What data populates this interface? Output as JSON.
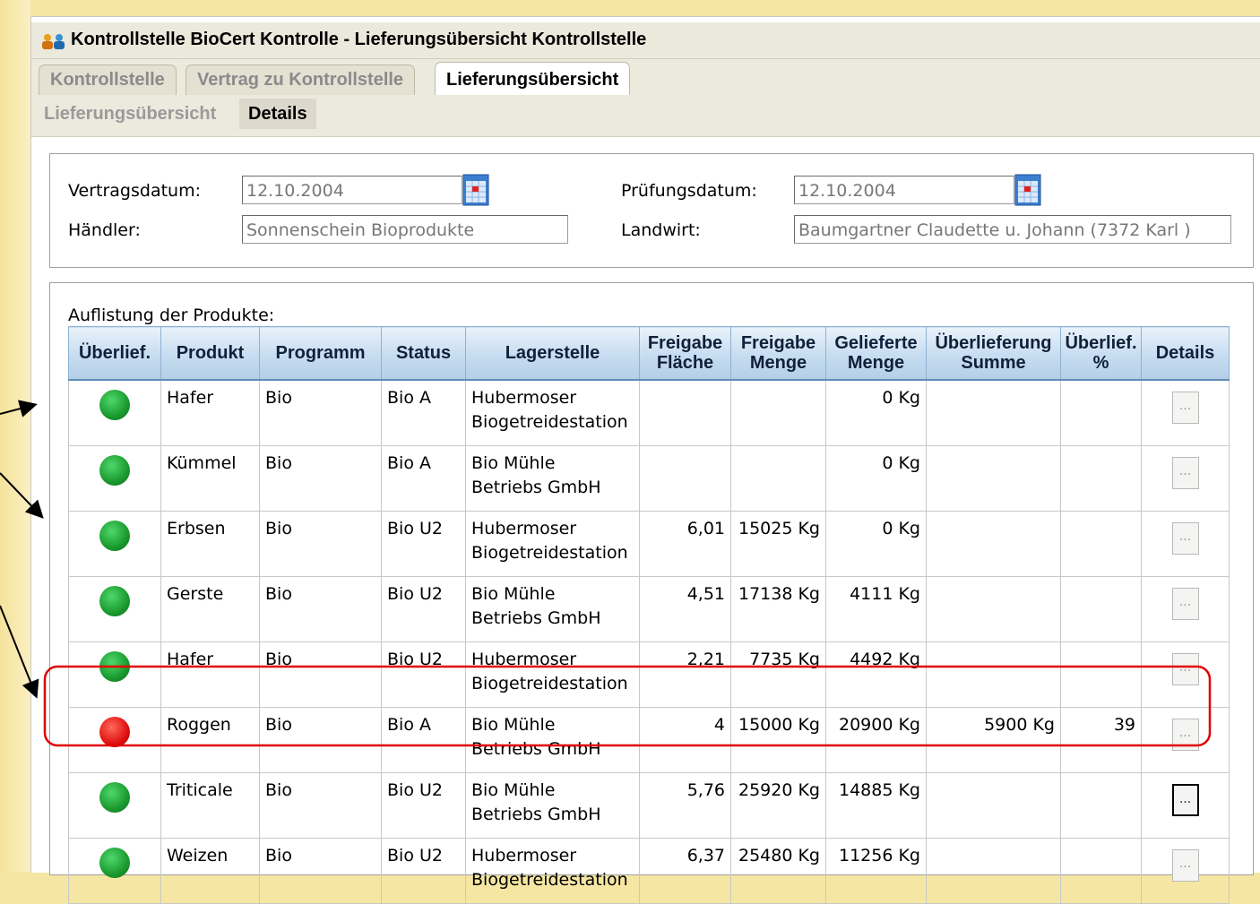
{
  "window": {
    "title": "Kontrollstelle BioCert Kontrolle - Lieferungsübersicht Kontrollstelle"
  },
  "tabs": [
    {
      "label": "Kontrollstelle",
      "active": false
    },
    {
      "label": "Vertrag zu Kontrollstelle",
      "active": false
    },
    {
      "label": "Lieferungsübersicht",
      "active": true
    }
  ],
  "subtabs": [
    {
      "label": "Lieferungsübersicht",
      "active": false
    },
    {
      "label": "Details",
      "active": true
    }
  ],
  "form": {
    "vertragsdatum_label": "Vertragsdatum:",
    "vertragsdatum_value": "12.10.2004",
    "haendler_label": "Händler:",
    "haendler_value": "Sonnenschein Bioprodukte",
    "pruefungsdatum_label": "Prüfungsdatum:",
    "pruefungsdatum_value": "12.10.2004",
    "landwirt_label": "Landwirt:",
    "landwirt_value": "Baumgartner Claudette u. Johann (7372 Karl )"
  },
  "products": {
    "title": "Auflistung der Produkte:",
    "columns": [
      "Überlief.",
      "Produkt",
      "Programm",
      "Status",
      "Lagerstelle",
      "Freigabe Fläche",
      "Freigabe Menge",
      "Gelieferte Menge",
      "Überlieferung Summe",
      "Überlief. %",
      "Details"
    ],
    "details_button_label": "...",
    "rows": [
      {
        "status_color": "green",
        "produkt": "Hafer",
        "programm": "Bio",
        "status": "Bio A",
        "lager1": "Hubermoser",
        "lager2": "Biogetreidestation",
        "flaeche": "",
        "menge": "",
        "geliefert": "0 Kg",
        "summe": "",
        "prozent": ""
      },
      {
        "status_color": "green",
        "produkt": "Kümmel",
        "programm": "Bio",
        "status": "Bio A",
        "lager1": "Bio Mühle",
        "lager2": "Betriebs GmbH",
        "flaeche": "",
        "menge": "",
        "geliefert": "0 Kg",
        "summe": "",
        "prozent": ""
      },
      {
        "status_color": "green",
        "produkt": "Erbsen",
        "programm": "Bio",
        "status": "Bio U2",
        "lager1": "Hubermoser",
        "lager2": "Biogetreidestation",
        "flaeche": "6,01",
        "menge": "15025 Kg",
        "geliefert": "0 Kg",
        "summe": "",
        "prozent": ""
      },
      {
        "status_color": "green",
        "produkt": "Gerste",
        "programm": "Bio",
        "status": "Bio U2",
        "lager1": "Bio Mühle",
        "lager2": "Betriebs GmbH",
        "flaeche": "4,51",
        "menge": "17138 Kg",
        "geliefert": "4111 Kg",
        "summe": "",
        "prozent": ""
      },
      {
        "status_color": "green",
        "produkt": "Hafer",
        "programm": "Bio",
        "status": "Bio U2",
        "lager1": "Hubermoser",
        "lager2": "Biogetreidestation",
        "flaeche": "2,21",
        "menge": "7735 Kg",
        "geliefert": "4492 Kg",
        "summe": "",
        "prozent": ""
      },
      {
        "status_color": "red",
        "produkt": "Roggen",
        "programm": "Bio",
        "status": "Bio A",
        "lager1": "Bio Mühle",
        "lager2": "Betriebs GmbH",
        "flaeche": "4",
        "menge": "15000 Kg",
        "geliefert": "20900 Kg",
        "summe": "5900 Kg",
        "prozent": "39"
      },
      {
        "status_color": "green",
        "produkt": "Triticale",
        "programm": "Bio",
        "status": "Bio U2",
        "lager1": "Bio Mühle",
        "lager2": "Betriebs GmbH",
        "flaeche": "5,76",
        "menge": "25920 Kg",
        "geliefert": "14885 Kg",
        "summe": "",
        "prozent": ""
      },
      {
        "status_color": "green",
        "produkt": "Weizen",
        "programm": "Bio",
        "status": "Bio U2",
        "lager1": "Hubermoser",
        "lager2": "Biogetreidestation",
        "flaeche": "6,37",
        "menge": "25480 Kg",
        "geliefert": "11256 Kg",
        "summe": "",
        "prozent": ""
      }
    ]
  },
  "colors": {
    "led_green": "#1a9a2e",
    "led_red": "#e01010",
    "highlight": "#e00000",
    "header_blue": "#c6dcf0",
    "background": "#f6e6a3"
  },
  "icons": {
    "title": "users-icon",
    "date_picker": "calendar-icon",
    "status": "status-led-icon"
  }
}
